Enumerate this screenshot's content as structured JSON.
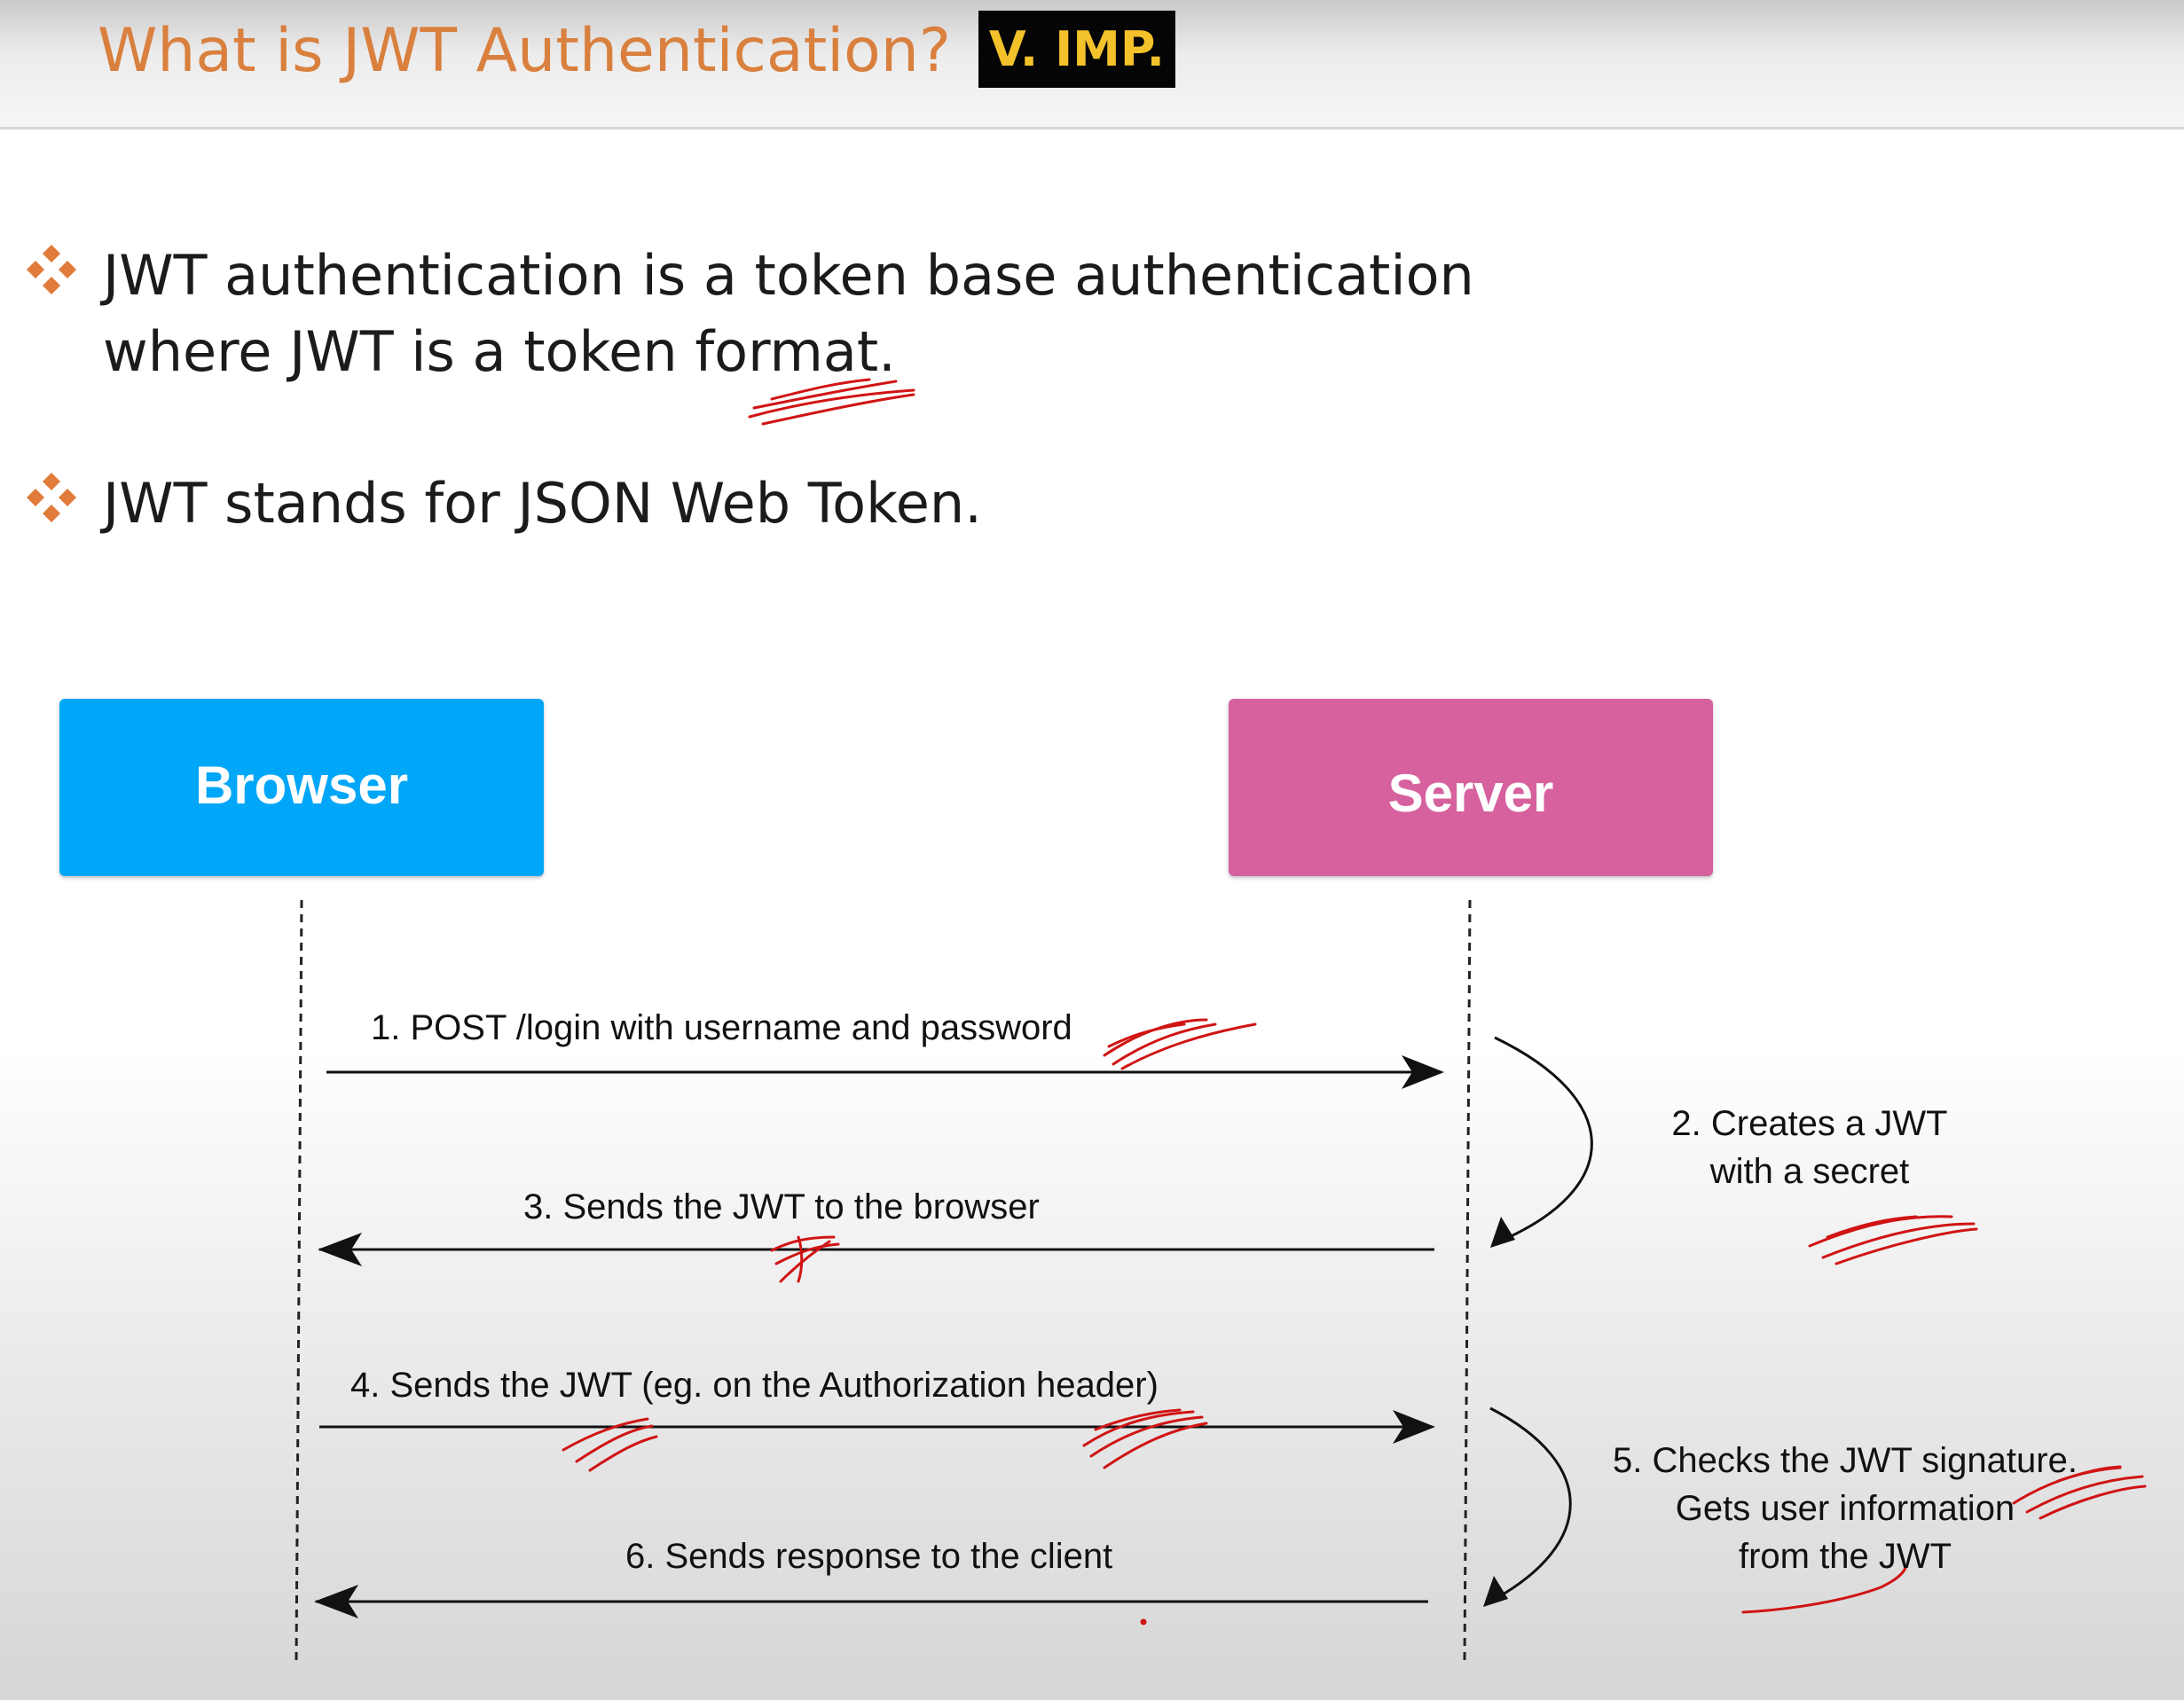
{
  "slide": {
    "title": "What is JWT Authentication?",
    "badge": "V. IMP."
  },
  "bullets": [
    {
      "lines": [
        "JWT authentication is a token base authentication",
        "where JWT is a token format."
      ],
      "icon": "four-diamond-bullet-icon"
    },
    {
      "lines": [
        "JWT stands for JSON Web Token."
      ],
      "icon": "four-diamond-bullet-icon"
    }
  ],
  "diagram": {
    "actors": {
      "browser": "Browser",
      "server": "Server"
    },
    "messages": [
      "1. POST /login with username and password",
      "3. Sends the JWT to the browser",
      "4. Sends the JWT (eg. on the Authorization header)",
      "6. Sends response to the client"
    ],
    "server_notes": {
      "step2": [
        "2. Creates a JWT",
        "with a secret"
      ],
      "step5": [
        "5. Checks the JWT signature.",
        "Gets user information",
        "from the JWT"
      ]
    }
  },
  "colors": {
    "title": "#d9803e",
    "badge_background": "#050505",
    "badge_text": "#f3c22b",
    "bullet_icon": "#e07b39",
    "browser": "#00a6f7",
    "server": "#d6619e",
    "annotation_ink": "#d01414"
  }
}
